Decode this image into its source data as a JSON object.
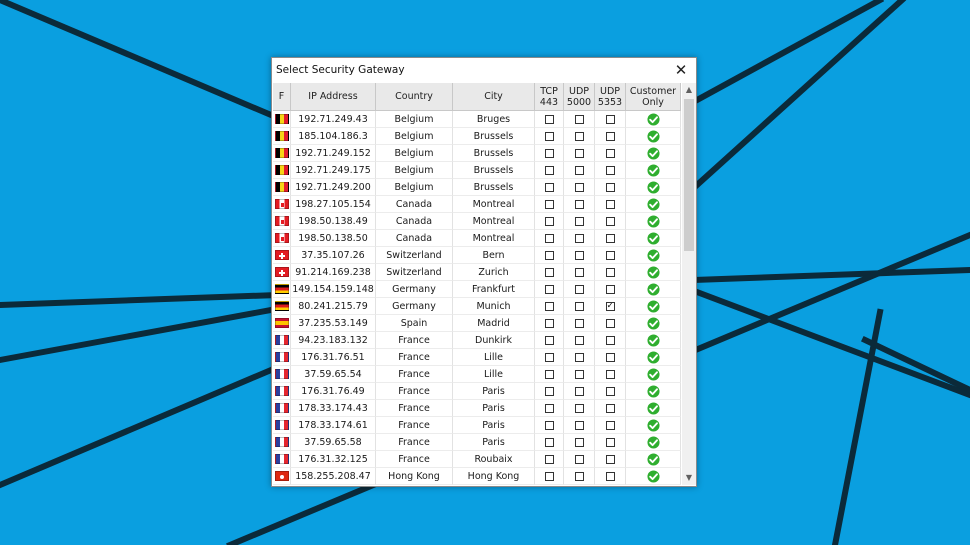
{
  "dialog": {
    "title": "Select Security Gateway"
  },
  "columns": [
    "F",
    "IP Address",
    "Country",
    "City",
    "TCP\n443",
    "UDP\n5000",
    "UDP\n5353",
    "Customer\nOnly"
  ],
  "rows": [
    {
      "flag": "belgium-flag",
      "ip": "192.71.249.43",
      "country": "Belgium",
      "city": "Bruges",
      "tcp443": false,
      "udp5000": false,
      "udp5353": false,
      "customer_only": true
    },
    {
      "flag": "belgium-flag",
      "ip": "185.104.186.3",
      "country": "Belgium",
      "city": "Brussels",
      "tcp443": false,
      "udp5000": false,
      "udp5353": false,
      "customer_only": true
    },
    {
      "flag": "belgium-flag",
      "ip": "192.71.249.152",
      "country": "Belgium",
      "city": "Brussels",
      "tcp443": false,
      "udp5000": false,
      "udp5353": false,
      "customer_only": true
    },
    {
      "flag": "belgium-flag",
      "ip": "192.71.249.175",
      "country": "Belgium",
      "city": "Brussels",
      "tcp443": false,
      "udp5000": false,
      "udp5353": false,
      "customer_only": true
    },
    {
      "flag": "belgium-flag",
      "ip": "192.71.249.200",
      "country": "Belgium",
      "city": "Brussels",
      "tcp443": false,
      "udp5000": false,
      "udp5353": false,
      "customer_only": true
    },
    {
      "flag": "canada-flag",
      "ip": "198.27.105.154",
      "country": "Canada",
      "city": "Montreal",
      "tcp443": false,
      "udp5000": false,
      "udp5353": false,
      "customer_only": true
    },
    {
      "flag": "canada-flag",
      "ip": "198.50.138.49",
      "country": "Canada",
      "city": "Montreal",
      "tcp443": false,
      "udp5000": false,
      "udp5353": false,
      "customer_only": true
    },
    {
      "flag": "canada-flag",
      "ip": "198.50.138.50",
      "country": "Canada",
      "city": "Montreal",
      "tcp443": false,
      "udp5000": false,
      "udp5353": false,
      "customer_only": true
    },
    {
      "flag": "switzerland-flag",
      "ip": "37.35.107.26",
      "country": "Switzerland",
      "city": "Bern",
      "tcp443": false,
      "udp5000": false,
      "udp5353": false,
      "customer_only": true
    },
    {
      "flag": "switzerland-flag",
      "ip": "91.214.169.238",
      "country": "Switzerland",
      "city": "Zurich",
      "tcp443": false,
      "udp5000": false,
      "udp5353": false,
      "customer_only": true
    },
    {
      "flag": "germany-flag",
      "ip": "149.154.159.148",
      "country": "Germany",
      "city": "Frankfurt",
      "tcp443": false,
      "udp5000": false,
      "udp5353": false,
      "customer_only": true
    },
    {
      "flag": "germany-flag",
      "ip": "80.241.215.79",
      "country": "Germany",
      "city": "Munich",
      "tcp443": false,
      "udp5000": false,
      "udp5353": true,
      "customer_only": true
    },
    {
      "flag": "spain-flag",
      "ip": "37.235.53.149",
      "country": "Spain",
      "city": "Madrid",
      "tcp443": false,
      "udp5000": false,
      "udp5353": false,
      "customer_only": true
    },
    {
      "flag": "france-flag",
      "ip": "94.23.183.132",
      "country": "France",
      "city": "Dunkirk",
      "tcp443": false,
      "udp5000": false,
      "udp5353": false,
      "customer_only": true
    },
    {
      "flag": "france-flag",
      "ip": "176.31.76.51",
      "country": "France",
      "city": "Lille",
      "tcp443": false,
      "udp5000": false,
      "udp5353": false,
      "customer_only": true
    },
    {
      "flag": "france-flag",
      "ip": "37.59.65.54",
      "country": "France",
      "city": "Lille",
      "tcp443": false,
      "udp5000": false,
      "udp5353": false,
      "customer_only": true
    },
    {
      "flag": "france-flag",
      "ip": "176.31.76.49",
      "country": "France",
      "city": "Paris",
      "tcp443": false,
      "udp5000": false,
      "udp5353": false,
      "customer_only": true
    },
    {
      "flag": "france-flag",
      "ip": "178.33.174.43",
      "country": "France",
      "city": "Paris",
      "tcp443": false,
      "udp5000": false,
      "udp5353": false,
      "customer_only": true
    },
    {
      "flag": "france-flag",
      "ip": "178.33.174.61",
      "country": "France",
      "city": "Paris",
      "tcp443": false,
      "udp5000": false,
      "udp5353": false,
      "customer_only": true
    },
    {
      "flag": "france-flag",
      "ip": "37.59.65.58",
      "country": "France",
      "city": "Paris",
      "tcp443": false,
      "udp5000": false,
      "udp5353": false,
      "customer_only": true
    },
    {
      "flag": "france-flag",
      "ip": "176.31.32.125",
      "country": "France",
      "city": "Roubaix",
      "tcp443": false,
      "udp5000": false,
      "udp5353": false,
      "customer_only": true
    },
    {
      "flag": "hong-kong-flag",
      "ip": "158.255.208.47",
      "country": "Hong Kong",
      "city": "Hong Kong",
      "tcp443": false,
      "udp5000": false,
      "udp5353": false,
      "customer_only": true
    }
  ],
  "colors": {
    "desktop_background": "#0a9fe0",
    "desktop_line": "#0b2a3a",
    "header_background": "#e9e9e9",
    "check_green": "#2fae2f"
  },
  "icons": {
    "close": "close-icon",
    "scroll_up": "scroll-up-arrow-icon",
    "scroll_down": "scroll-down-arrow-icon",
    "customer_only": "green-check-icon"
  }
}
